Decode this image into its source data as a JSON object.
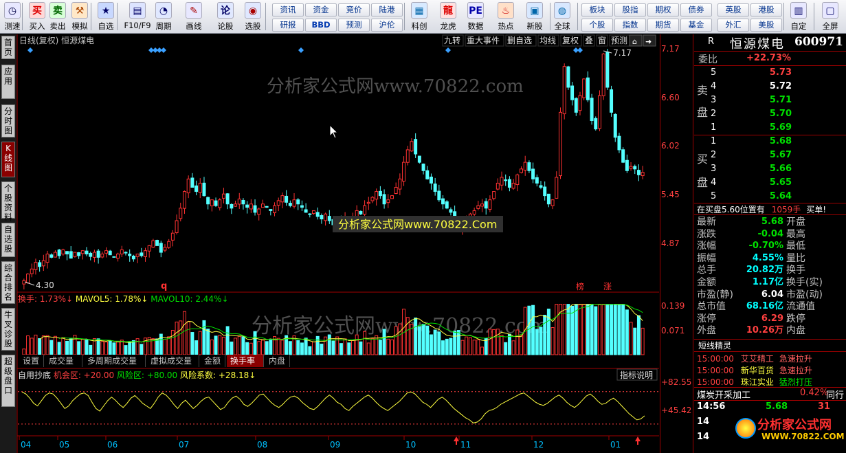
{
  "toolbar": {
    "items": [
      {
        "label": "测速",
        "icon": "clock-icon"
      },
      {
        "label": "买入",
        "icon": "buy-icon",
        "glyph": "买"
      },
      {
        "label": "卖出",
        "icon": "sell-icon",
        "glyph": "卖"
      },
      {
        "label": "模拟",
        "icon": "hammer-icon"
      },
      {
        "label": "自选",
        "icon": "star-icon"
      },
      {
        "label": "F10/F9",
        "icon": "f10-icon"
      },
      {
        "label": "周期",
        "icon": "cycle-icon"
      },
      {
        "label": "画线",
        "icon": "pen-icon"
      },
      {
        "label": "论股",
        "icon": "discuss-icon",
        "glyph": "论"
      },
      {
        "label": "选股",
        "icon": "select-icon"
      },
      {
        "label": "科创",
        "icon": "kechuang-icon"
      },
      {
        "label": "龙虎",
        "icon": "dragon-tiger-icon"
      },
      {
        "label": "数据",
        "icon": "pe-icon",
        "glyph": "PE"
      },
      {
        "label": "热点",
        "icon": "hot-icon"
      },
      {
        "label": "新股",
        "icon": "new-stock-icon"
      },
      {
        "label": "全球",
        "icon": "globe-icon"
      },
      {
        "label": "自定",
        "icon": "custom-icon"
      },
      {
        "label": "全屏",
        "icon": "fullscreen-icon"
      }
    ],
    "small_buttons": [
      "资讯",
      "资金",
      "竞价",
      "陆港",
      "研报",
      "BBD",
      "预测",
      "沪伦",
      "板块",
      "股指",
      "期权",
      "债券",
      "英股",
      "港股",
      "个股",
      "指数",
      "期货",
      "基金",
      "外汇",
      "美股"
    ]
  },
  "left_nav": [
    {
      "label": "首页"
    },
    {
      "label": "应用"
    },
    {
      "label": "分时图"
    },
    {
      "label": "K线图"
    },
    {
      "label": "个股资料"
    },
    {
      "label": "自选股"
    },
    {
      "label": "综合排名"
    },
    {
      "label": "牛叉诊股"
    },
    {
      "label": "超级盘口"
    }
  ],
  "chart_header": {
    "title": "日线(复权) 恒源煤电",
    "buttons": [
      "九转",
      "重大事件",
      "删自选",
      "均线",
      "复权",
      "叠",
      "窗",
      "预测"
    ]
  },
  "watermark_big": "分析家公式网www.70822.com",
  "watermark_small": "分析家公式网www.70822.Com",
  "markers": {
    "q": "q",
    "bang": "榜",
    "zhang": "涨",
    "high": "7.17",
    "low": "4.30"
  },
  "price_axis": [
    "7.17",
    "6.60",
    "6.02",
    "5.45",
    "4.87"
  ],
  "volume_header": {
    "a": "换手: 1.73%↓",
    "b": "MAVOL5: 1.78%↓",
    "c": "MAVOL10: 2.44%↓"
  },
  "volume_axis": [
    "0.139",
    "0.071"
  ],
  "tabs": [
    "设置",
    "成交量",
    "多周期成交量",
    "虚拟成交量",
    "金额",
    "换手率",
    "内盘"
  ],
  "indicator_header": {
    "a": "自用抄底",
    "b": "机会区: +20.00",
    "c": "风险区: +80.00",
    "d": "风险系数: +28.18↓",
    "btn": "指标说明"
  },
  "indicator_axis": [
    "+82.55",
    "+45.42"
  ],
  "months": [
    "04",
    "05",
    "06",
    "07",
    "08",
    "09",
    "10",
    "11",
    "12",
    "01"
  ],
  "right_panel": {
    "flag": "R",
    "name": "恒源煤电",
    "code": "600971",
    "weibi_label": "委比",
    "weibi": "+22.73%",
    "sell_label": [
      "卖",
      "盘"
    ],
    "buy_label": [
      "买",
      "盘"
    ],
    "sell": [
      {
        "n": "5",
        "p": "5.73"
      },
      {
        "n": "4",
        "p": "5.72"
      },
      {
        "n": "3",
        "p": "5.71"
      },
      {
        "n": "2",
        "p": "5.70"
      },
      {
        "n": "1",
        "p": "5.69"
      }
    ],
    "buy": [
      {
        "n": "1",
        "p": "5.68"
      },
      {
        "n": "2",
        "p": "5.67"
      },
      {
        "n": "3",
        "p": "5.66"
      },
      {
        "n": "4",
        "p": "5.65"
      },
      {
        "n": "5",
        "p": "5.64"
      }
    ],
    "alert_a": "在买盘5.60位置有",
    "alert_b": "1059手",
    "alert_c": "买单!",
    "stats": [
      {
        "l": "最新",
        "v": "5.68",
        "c": "grn",
        "r": "开盘"
      },
      {
        "l": "涨跌",
        "v": "-0.04",
        "c": "grn",
        "r": "最高"
      },
      {
        "l": "涨幅",
        "v": "-0.70%",
        "c": "grn",
        "r": "最低"
      },
      {
        "l": "振幅",
        "v": "4.55%",
        "c": "cyn",
        "r": "量比"
      },
      {
        "l": "总手",
        "v": "20.82万",
        "c": "cyn",
        "r": "换手"
      },
      {
        "l": "金额",
        "v": "1.17亿",
        "c": "cyn",
        "r": "换手(实)"
      },
      {
        "l": "市盈(静)",
        "v": "6.04",
        "c": "wht",
        "r": "市盈(动)"
      },
      {
        "l": "总市值",
        "v": "68.16亿",
        "c": "cyn",
        "r": "流通值"
      },
      {
        "l": "涨停",
        "v": "6.29",
        "c": "red",
        "r": "跌停"
      },
      {
        "l": "外盘",
        "v": "10.26万",
        "c": "red",
        "r": "内盘"
      }
    ],
    "short_title": "短线精灵",
    "short_rows": [
      {
        "t": "15:00:00",
        "s": "艾艾精工",
        "e": "急速拉升"
      },
      {
        "t": "15:00:00",
        "s": "新华百货",
        "e": "急速拉升"
      },
      {
        "t": "15:00:00",
        "s": "珠江实业",
        "e": "猛烈打压"
      }
    ],
    "sector": "煤炭开采加工",
    "sector_pct": "0.42%",
    "sector_btn": "同行",
    "tick": {
      "t": "14:56",
      "p": "5.68",
      "v": "31"
    },
    "tick2": "14",
    "tick3": "14"
  },
  "logo": {
    "text": "分析家公式网",
    "url": "WWW.70822.COM"
  },
  "chart_data": {
    "type": "candlestick",
    "title": "日线(复权) 恒源煤电",
    "ylim": [
      4.3,
      7.17
    ],
    "months": [
      "04",
      "05",
      "06",
      "07",
      "08",
      "09",
      "10",
      "11",
      "12",
      "01"
    ],
    "close": [
      4.38,
      4.46,
      4.52,
      4.6,
      4.55,
      4.62,
      4.7,
      4.66,
      4.72,
      4.68,
      4.75,
      4.7,
      4.65,
      4.72,
      4.68,
      4.74,
      4.7,
      4.67,
      4.72,
      4.66,
      4.7,
      4.74,
      4.69,
      4.66,
      4.7,
      4.75,
      4.72,
      4.68,
      4.64,
      4.7,
      4.68,
      4.74,
      4.8,
      4.86,
      4.8,
      4.72,
      4.78,
      4.85,
      4.95,
      5.1,
      5.25,
      5.45,
      5.6,
      5.5,
      5.45,
      5.55,
      5.4,
      5.3,
      5.35,
      5.28,
      5.35,
      5.42,
      5.3,
      5.25,
      5.3,
      5.36,
      5.3,
      5.26,
      5.3,
      5.2,
      5.24,
      5.3,
      5.26,
      5.22,
      5.28,
      5.34,
      5.4,
      5.32,
      5.28,
      5.35,
      5.3,
      5.26,
      5.2,
      5.18,
      5.22,
      5.15,
      5.12,
      5.18,
      5.1,
      5.05,
      5.12,
      5.08,
      5.14,
      5.1,
      5.15,
      5.22,
      5.18,
      5.28,
      5.32,
      5.38,
      5.45,
      5.4,
      5.3,
      5.35,
      5.4,
      5.5,
      5.6,
      5.8,
      5.95,
      6.05,
      5.9,
      5.8,
      5.7,
      5.6,
      5.55,
      5.45,
      5.35,
      5.3,
      5.25,
      5.2,
      5.1,
      5.0,
      5.05,
      5.12,
      5.18,
      5.22,
      5.28,
      5.3,
      5.25,
      5.35,
      5.45,
      5.55,
      5.62,
      5.58,
      5.5,
      5.55,
      5.65,
      5.72,
      5.8,
      5.7,
      5.6,
      5.55,
      5.5,
      5.4,
      5.3,
      5.35,
      5.62,
      6.4,
      6.95,
      6.7,
      6.55,
      6.4,
      6.6,
      6.8,
      6.55,
      6.3,
      6.2,
      6.6,
      7.1,
      6.7,
      6.4,
      6.1,
      5.95,
      5.8,
      5.7,
      5.75,
      5.72,
      5.65,
      5.68
    ]
  },
  "indicator_data": [
    82,
    78,
    70,
    60,
    55,
    65,
    75,
    80,
    78,
    70,
    60,
    50,
    55,
    65,
    72,
    78,
    80,
    75,
    62,
    50,
    45,
    55,
    65,
    72,
    66,
    58,
    52,
    60,
    70,
    75,
    68,
    60,
    55,
    50,
    60,
    72,
    80,
    76,
    68,
    58,
    50,
    60,
    66,
    58,
    50,
    56,
    64,
    70,
    72,
    64,
    56,
    48,
    52,
    62,
    70,
    74,
    68,
    58,
    54,
    60,
    68,
    76,
    78,
    70,
    62,
    56,
    52,
    58,
    66,
    72,
    74,
    70,
    62,
    56,
    50,
    48,
    54,
    62,
    70,
    76,
    70,
    62,
    58,
    50,
    46,
    54,
    60,
    66,
    72,
    76,
    70,
    62,
    55,
    50,
    46,
    52,
    58,
    64,
    72,
    80,
    82,
    78,
    70,
    62,
    58,
    52,
    60,
    68,
    72,
    66,
    58,
    50,
    44,
    38,
    32,
    28,
    22,
    24,
    30,
    40,
    46,
    48,
    52,
    58,
    62,
    66,
    70,
    74,
    78,
    80,
    74,
    68,
    62,
    58,
    56,
    60,
    66,
    72,
    76,
    70,
    62,
    56,
    52,
    58,
    66,
    74,
    78,
    72,
    64,
    58,
    60,
    66,
    70,
    64,
    56,
    48,
    40,
    34,
    28,
    30,
    36
  ]
}
